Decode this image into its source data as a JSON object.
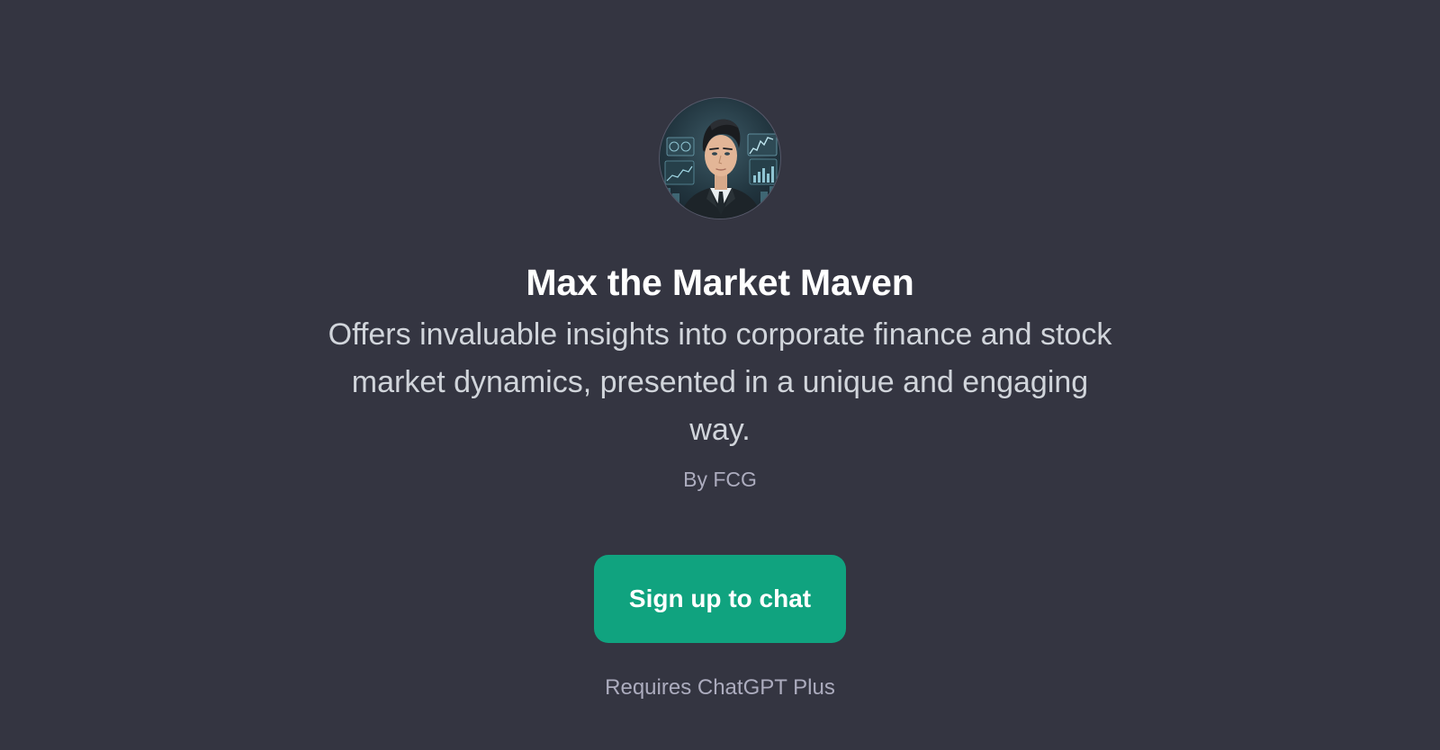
{
  "gpt": {
    "name": "Max the Market Maven",
    "description": "Offers invaluable insights into corporate finance and stock market dynamics, presented in a unique and engaging way.",
    "author": "By FCG",
    "avatar_icon": "portrait-avatar"
  },
  "cta": {
    "label": "Sign up to chat",
    "color": "#10a37f"
  },
  "footer": {
    "requirement": "Requires ChatGPT Plus"
  },
  "theme": {
    "background": "#343541",
    "title_color": "#ffffff",
    "text_color": "#d1d5db",
    "muted_color": "#acacbe"
  }
}
